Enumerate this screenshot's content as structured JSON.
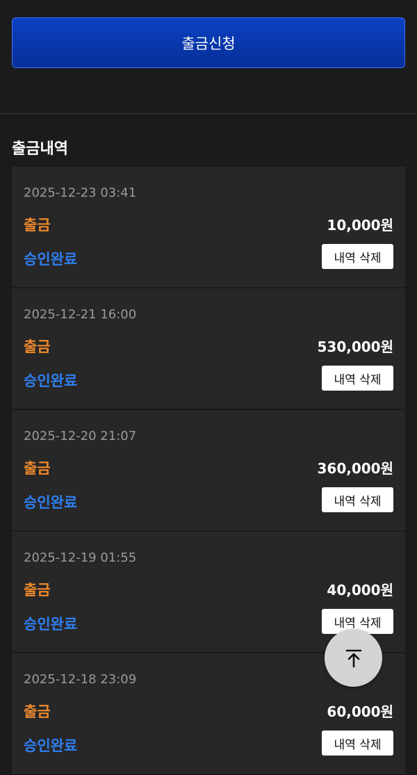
{
  "header": {
    "withdraw_button_label": "출금신청"
  },
  "history": {
    "title": "출금내역",
    "items": [
      {
        "date": "2025-12-23 03:41",
        "type": "출금",
        "amount": "10,000원",
        "status": "승인완료",
        "delete_label": "내역 삭제"
      },
      {
        "date": "2025-12-21 16:00",
        "type": "출금",
        "amount": "530,000원",
        "status": "승인완료",
        "delete_label": "내역 삭제"
      },
      {
        "date": "2025-12-20 21:07",
        "type": "출금",
        "amount": "360,000원",
        "status": "승인완료",
        "delete_label": "내역 삭제"
      },
      {
        "date": "2025-12-19 01:55",
        "type": "출금",
        "amount": "40,000원",
        "status": "승인완료",
        "delete_label": "내역 삭제"
      },
      {
        "date": "2025-12-18 23:09",
        "type": "출금",
        "amount": "60,000원",
        "status": "승인완료",
        "delete_label": "내역 삭제"
      }
    ]
  },
  "icons": {
    "scroll_top": "arrow-up-to-line-icon"
  },
  "colors": {
    "background": "#1b1b1c",
    "card": "#272727",
    "type_orange": "#f08a2c",
    "status_blue": "#2f7ff0",
    "button_blue": "#0b41c2"
  }
}
